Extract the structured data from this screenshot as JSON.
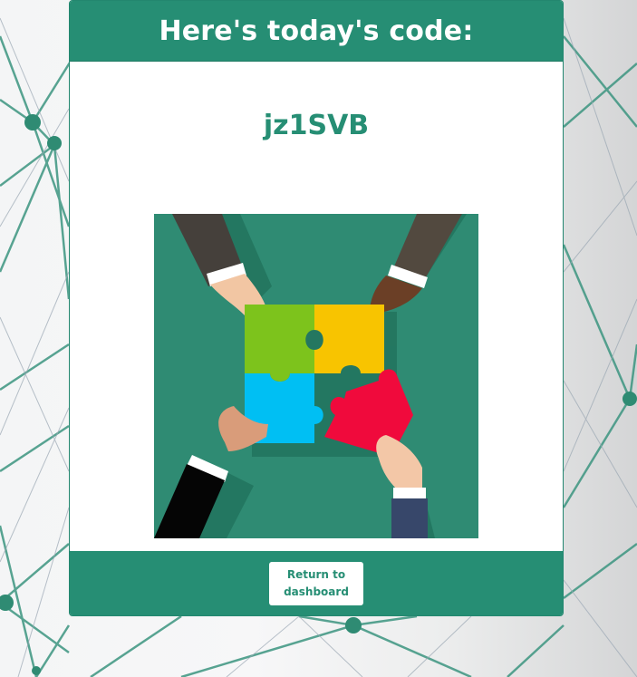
{
  "header": {
    "title": "Here's today's code:"
  },
  "code": {
    "value": "jz1SVB"
  },
  "illustration": {
    "icon": "puzzle-hands-illustration"
  },
  "footer": {
    "return_button_label": "Return to dashboard"
  },
  "colors": {
    "brand": "#268e74",
    "illustration_bg": "#2f8b73",
    "piece_green": "#7dc31c",
    "piece_yellow": "#f8c400",
    "piece_blue": "#00bff3",
    "piece_red": "#f00a3c"
  }
}
